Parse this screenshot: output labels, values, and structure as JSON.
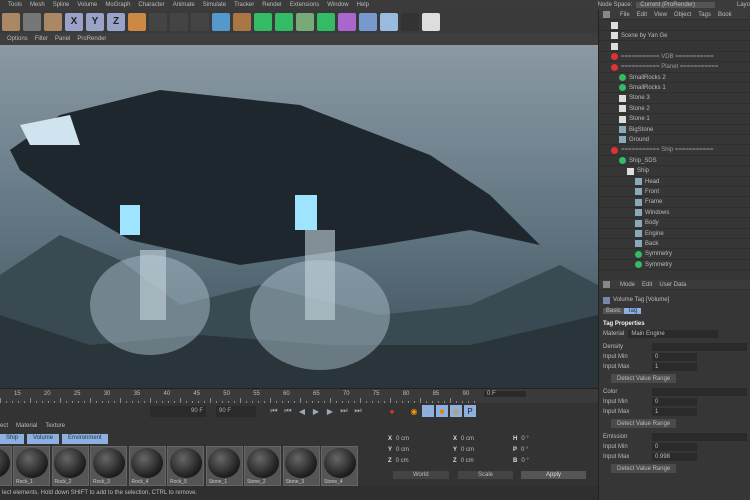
{
  "menubar": {
    "items": [
      "Tools",
      "Mesh",
      "Spline",
      "Volume",
      "MoGraph",
      "Character",
      "Animate",
      "Simulate",
      "Tracker",
      "Render",
      "Extensions",
      "Window",
      "Help"
    ],
    "node_space_label": "Node Space:",
    "node_space_value": "Current (ProRender)",
    "layout": "Layo"
  },
  "toolbar": {
    "xyz": [
      "X",
      "Y",
      "Z"
    ]
  },
  "viewport_menu": [
    "Options",
    "Filter",
    "Panel",
    "ProRender"
  ],
  "timeline": {
    "ticks": [
      "15",
      "20",
      "25",
      "30",
      "35",
      "40",
      "45",
      "50",
      "55",
      "60",
      "65",
      "70",
      "75",
      "80",
      "85",
      "90"
    ],
    "current": "0 F",
    "end_field": "90 F",
    "end_field2": "90 F"
  },
  "material_manager": {
    "menu": [
      "ect",
      "Material",
      "Texture"
    ],
    "tabs": [
      "Ship",
      "Volume",
      "Environment"
    ],
    "materials": [
      "Rock_1",
      "Rock_2",
      "Rock_3",
      "Rock_4",
      "Rock_5",
      "Stone_1",
      "Stone_2",
      "Stone_3",
      "Stone_4"
    ]
  },
  "coords": {
    "labels": [
      "X",
      "Y",
      "Z"
    ],
    "pos": [
      "0 cm",
      "0 cm",
      "0 cm"
    ],
    "size": [
      "0 cm",
      "0 cm",
      "0 cm"
    ],
    "rot_labels": [
      "H",
      "P",
      "B"
    ],
    "rot": [
      "0 °",
      "0 °",
      "0 °"
    ],
    "mode1": "World",
    "mode2": "Scale",
    "apply": "Apply"
  },
  "status": "lect elements. Hold down SHIFT to add to the selection, CTRL to remove.",
  "object_manager": {
    "menu": [
      "File",
      "Edit",
      "View",
      "Object",
      "Tags",
      "Book"
    ],
    "items": [
      {
        "label": "",
        "type": "null",
        "indent": 0
      },
      {
        "label": "Scene by Yan Ge",
        "type": "null",
        "indent": 0
      },
      {
        "label": "",
        "type": "null",
        "indent": 0
      },
      {
        "label": "=========== VDB ===========",
        "type": "warn",
        "indent": 0
      },
      {
        "label": "=========== Planet ===========",
        "type": "warn",
        "indent": 0
      },
      {
        "label": "SmallRocks 2",
        "type": "green",
        "indent": 1
      },
      {
        "label": "SmallRocks 1",
        "type": "green",
        "indent": 1
      },
      {
        "label": "Stone 3",
        "type": "null",
        "indent": 1
      },
      {
        "label": "Stone 2",
        "type": "null",
        "indent": 1
      },
      {
        "label": "Stone 1",
        "type": "null",
        "indent": 1
      },
      {
        "label": "BigStone",
        "type": "poly",
        "indent": 1
      },
      {
        "label": "Ground",
        "type": "poly",
        "indent": 1
      },
      {
        "label": "=========== Ship ===========",
        "type": "warn",
        "indent": 0
      },
      {
        "label": "Ship_SDS",
        "type": "green",
        "indent": 1
      },
      {
        "label": "Ship",
        "type": "null",
        "indent": 2
      },
      {
        "label": "Head",
        "type": "poly",
        "indent": 3
      },
      {
        "label": "Front",
        "type": "poly",
        "indent": 3
      },
      {
        "label": "Frame",
        "type": "poly",
        "indent": 3
      },
      {
        "label": "Windows",
        "type": "poly",
        "indent": 3
      },
      {
        "label": "Body",
        "type": "poly",
        "indent": 3
      },
      {
        "label": "Engine",
        "type": "poly",
        "indent": 3
      },
      {
        "label": "Back",
        "type": "poly",
        "indent": 3
      },
      {
        "label": "Symmetry",
        "type": "green",
        "indent": 3
      },
      {
        "label": "Symmetry",
        "type": "green",
        "indent": 3
      }
    ]
  },
  "attributes": {
    "menu": [
      "Mode",
      "Edit",
      "User Data"
    ],
    "title": "Volume Tag [Volume]",
    "tabs": [
      "Basic",
      "Tag"
    ],
    "section": "Tag Properties",
    "material_label": "Material",
    "material_value": "Main Engine",
    "groups": [
      {
        "name": "Density",
        "min": "0",
        "max": "1"
      },
      {
        "name": "Color",
        "min": "0",
        "max": "1"
      },
      {
        "name": "Emission",
        "min": "0",
        "max": "0.998"
      }
    ],
    "input_min": "Input Min",
    "input_max": "Input Max",
    "detect": "Detect Value Range"
  }
}
